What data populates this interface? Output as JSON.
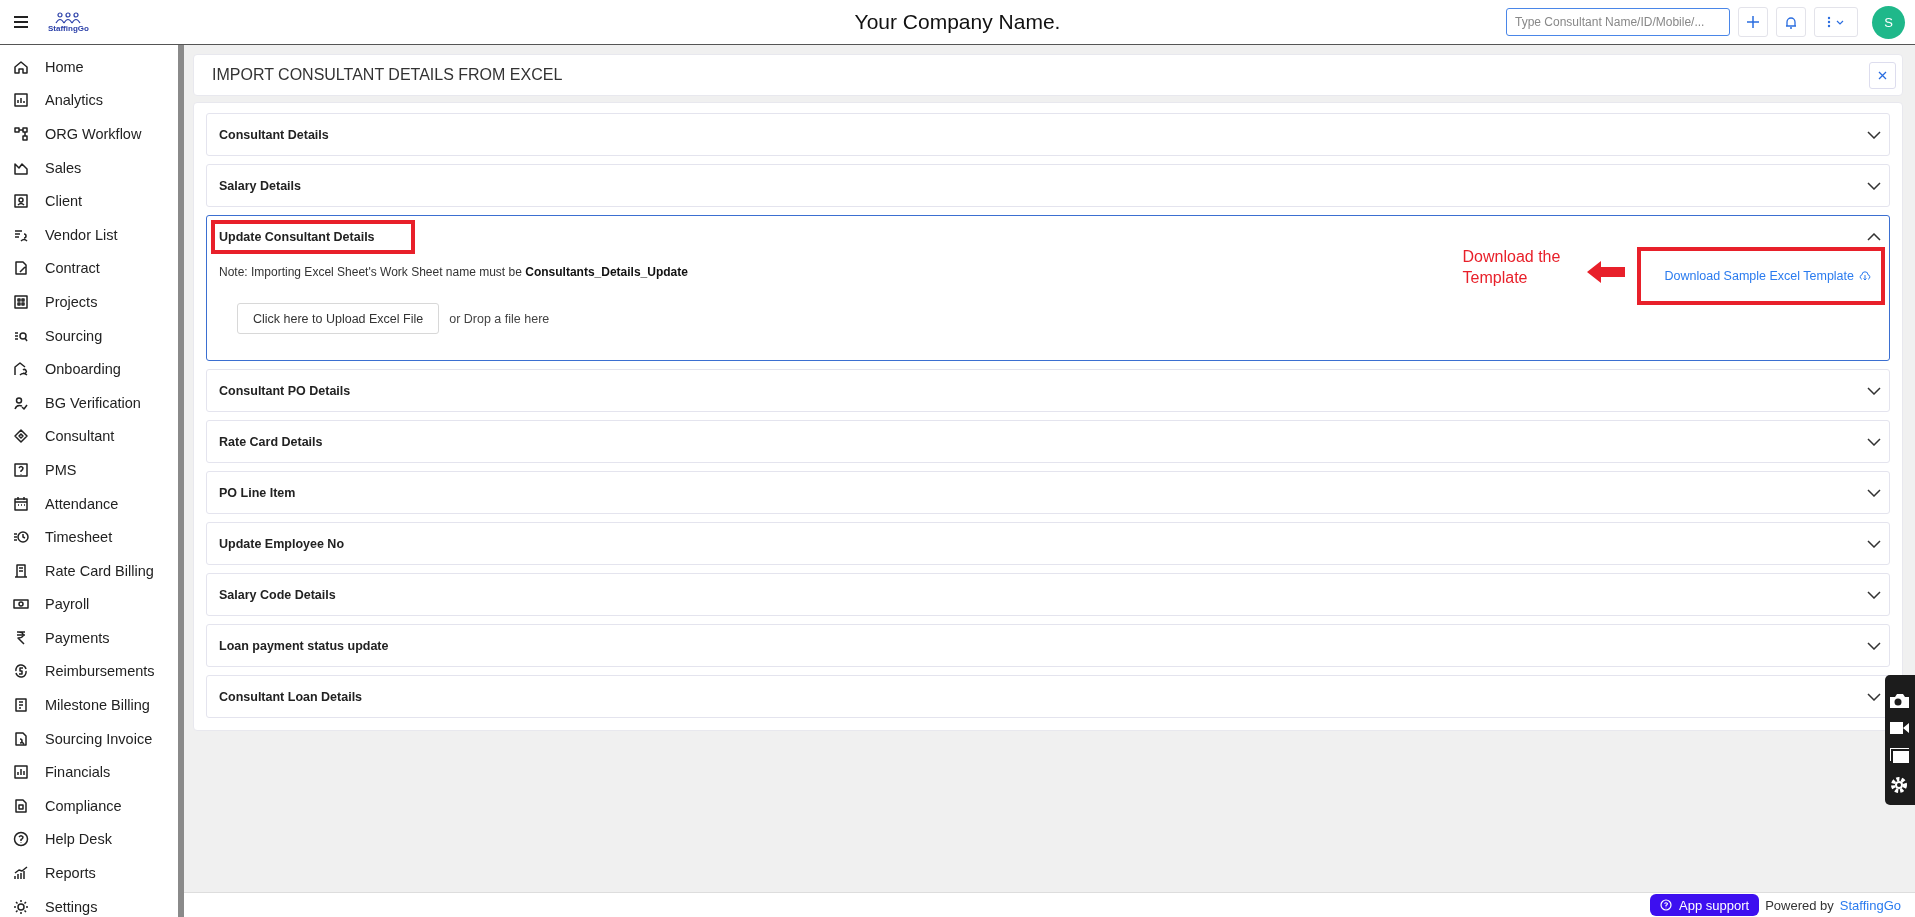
{
  "header": {
    "logo_text": "StaffingGo",
    "title": "Your Company Name.",
    "search": {
      "placeholder": "Type Consultant Name/ID/Mobile/..."
    },
    "avatar": "S"
  },
  "sidebar": {
    "items": [
      {
        "label": "Home"
      },
      {
        "label": "Analytics"
      },
      {
        "label": "ORG Workflow"
      },
      {
        "label": "Sales"
      },
      {
        "label": "Client"
      },
      {
        "label": "Vendor List"
      },
      {
        "label": "Contract"
      },
      {
        "label": "Projects"
      },
      {
        "label": "Sourcing"
      },
      {
        "label": "Onboarding"
      },
      {
        "label": "BG Verification"
      },
      {
        "label": "Consultant"
      },
      {
        "label": "PMS"
      },
      {
        "label": "Attendance"
      },
      {
        "label": "Timesheet"
      },
      {
        "label": "Rate Card Billing"
      },
      {
        "label": "Payroll"
      },
      {
        "label": "Payments"
      },
      {
        "label": "Reimbursements"
      },
      {
        "label": "Milestone Billing"
      },
      {
        "label": "Sourcing Invoice"
      },
      {
        "label": "Financials"
      },
      {
        "label": "Compliance"
      },
      {
        "label": "Help Desk"
      },
      {
        "label": "Reports"
      },
      {
        "label": "Settings"
      }
    ]
  },
  "page": {
    "title": "IMPORT CONSULTANT DETAILS FROM EXCEL",
    "sections": [
      {
        "title": "Consultant Details",
        "expanded": false,
        "highlighted": false
      },
      {
        "title": "Salary Details",
        "expanded": false,
        "highlighted": false
      },
      {
        "title": "Update Consultant Details",
        "expanded": true,
        "highlighted": true,
        "note": "Note: Importing Excel Sheet's Work Sheet name must be **Consultants_Details_Update**",
        "upload_button": "Click here to Upload Excel File",
        "drop_text": "or Drop a file here",
        "annotation": "Download the Template",
        "download_link": {
          "label": "Download Sample Excel Template",
          "highlighted": true
        }
      },
      {
        "title": "Consultant PO Details",
        "expanded": false,
        "highlighted": false
      },
      {
        "title": "Rate Card Details",
        "expanded": false,
        "highlighted": false
      },
      {
        "title": "PO Line Item",
        "expanded": false,
        "highlighted": false
      },
      {
        "title": "Update Employee No",
        "expanded": false,
        "highlighted": false
      },
      {
        "title": "Salary Code Details",
        "expanded": false,
        "highlighted": false
      },
      {
        "title": "Loan payment status update",
        "expanded": false,
        "highlighted": false
      },
      {
        "title": "Consultant Loan Details",
        "expanded": false,
        "highlighted": false
      }
    ]
  },
  "footer": {
    "support_button": "App support",
    "powered_by": "Powered by",
    "brand_link": "StaffingGo"
  }
}
